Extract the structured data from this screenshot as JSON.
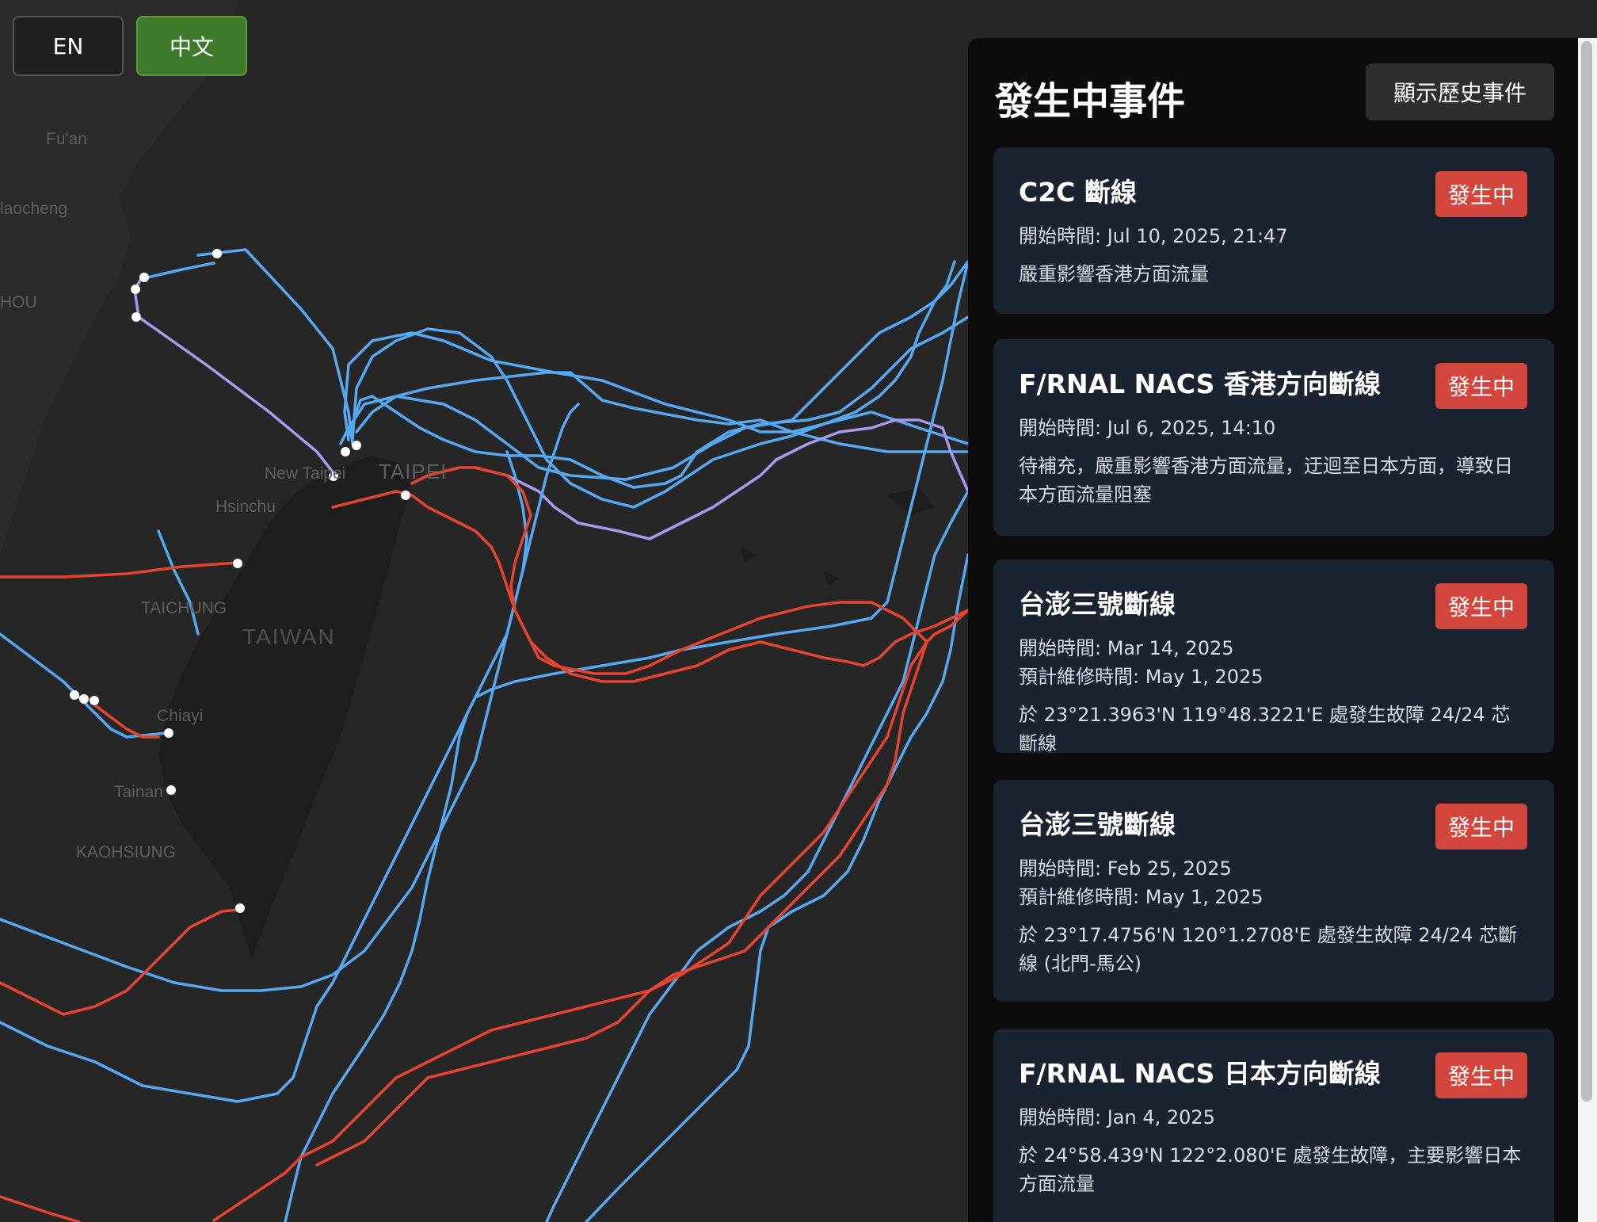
{
  "language_buttons": {
    "en": "EN",
    "zh": "中文"
  },
  "map_labels": {
    "fuan": "Fu'an",
    "laocheng": "laocheng",
    "hou": "HOU",
    "new_taipei": "New Taipei",
    "taipei": "TAIPEI",
    "hsinchu": "Hsinchu",
    "taichung": "TAICHUNG",
    "taiwan": "TAIWAN",
    "chiayi": "Chiayi",
    "tainan": "Tainan",
    "kaohsiung": "KAOHSIUNG"
  },
  "legend_colors": {
    "cable_active": "#55a9f2",
    "cable_faulty": "#e8432f",
    "cable_mixed": "#a99af0",
    "landing_point": "#ffffff"
  },
  "panel": {
    "title": "發生中事件",
    "history_button": "顯示歷史事件",
    "events": [
      {
        "title": "C2C 斷線",
        "status": "發生中",
        "start": "開始時間: Jul 10, 2025, 21:47",
        "repair": "",
        "description": "嚴重影響香港方面流量"
      },
      {
        "title": "F/RNAL NACS 香港方向斷線",
        "status": "發生中",
        "start": "開始時間: Jul 6, 2025, 14:10",
        "repair": "",
        "description": "待補充，嚴重影響香港方面流量，迂迴至日本方面，導致日本方面流量阻塞"
      },
      {
        "title": "台澎三號斷線",
        "status": "發生中",
        "start": "開始時間: Mar 14, 2025",
        "repair": "預計維修時間: May 1, 2025",
        "description": "於 23°21.3963'N 119°48.3221'E 處發生故障 24/24 芯斷線"
      },
      {
        "title": "台澎三號斷線",
        "status": "發生中",
        "start": "開始時間: Feb 25, 2025",
        "repair": "預計維修時間: May 1, 2025",
        "description": "於 23°17.4756'N 120°1.2708'E 處發生故障 24/24 芯斷線 (北門-馬公)"
      },
      {
        "title": "F/RNAL NACS 日本方向斷線",
        "status": "發生中",
        "start": "開始時間: Jan 4, 2025",
        "repair": "",
        "description": "於 24°58.439'N 122°2.080'E 處發生故障，主要影響日本方面流量"
      }
    ]
  }
}
